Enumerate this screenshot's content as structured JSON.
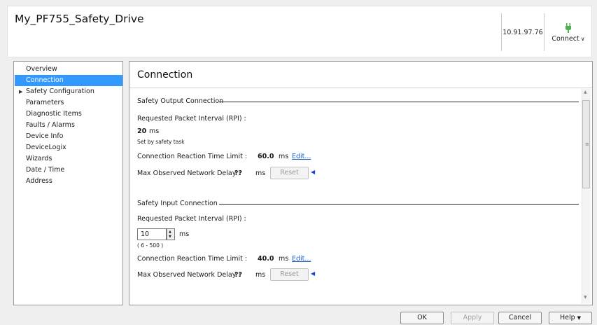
{
  "header": {
    "title": "My_PF755_Safety_Drive",
    "ip_address": "10.91.97.76",
    "connect_label": "Connect",
    "connect_icon": "plug-icon"
  },
  "nav": {
    "items": [
      {
        "label": "Overview",
        "selected": false
      },
      {
        "label": "Connection",
        "selected": true
      },
      {
        "label": "Safety Configuration",
        "expandable": true
      },
      {
        "label": "Parameters"
      },
      {
        "label": "Diagnostic Items"
      },
      {
        "label": "Faults / Alarms"
      },
      {
        "label": "Device Info"
      },
      {
        "label": "DeviceLogix"
      },
      {
        "label": "Wizards"
      },
      {
        "label": "Date / Time"
      },
      {
        "label": "Address"
      }
    ]
  },
  "content": {
    "title": "Connection",
    "safety_output": {
      "group_label": "Safety Output Connection",
      "rpi_label": "Requested Packet Interval (RPI) :",
      "rpi_value": "20",
      "rpi_unit": "ms",
      "rpi_note": "Set by safety task",
      "crtl_label": "Connection Reaction Time Limit :",
      "crtl_value": "60.0",
      "crtl_unit": "ms",
      "edit_link": "Edit...",
      "delay_label": "Max Observed Network Delay :",
      "delay_value": "??",
      "delay_unit": "ms",
      "reset_label": "Reset"
    },
    "safety_input": {
      "group_label": "Safety Input Connection",
      "rpi_label": "Requested Packet Interval (RPI) :",
      "rpi_value": "10",
      "rpi_unit": "ms",
      "rpi_range": "( 6  -  500 )",
      "crtl_label": "Connection Reaction Time Limit :",
      "crtl_value": "40.0",
      "crtl_unit": "ms",
      "edit_link": "Edit...",
      "delay_label": "Max Observed Network Delay :",
      "delay_value": "??",
      "delay_unit": "ms",
      "reset_label": "Reset"
    }
  },
  "footer": {
    "ok": "OK",
    "apply": "Apply",
    "cancel": "Cancel",
    "help": "Help"
  },
  "colors": {
    "selection": "#3399ff",
    "link": "#1a5fd0",
    "arrow": "#1c43d8",
    "plug": "#4caf50"
  }
}
